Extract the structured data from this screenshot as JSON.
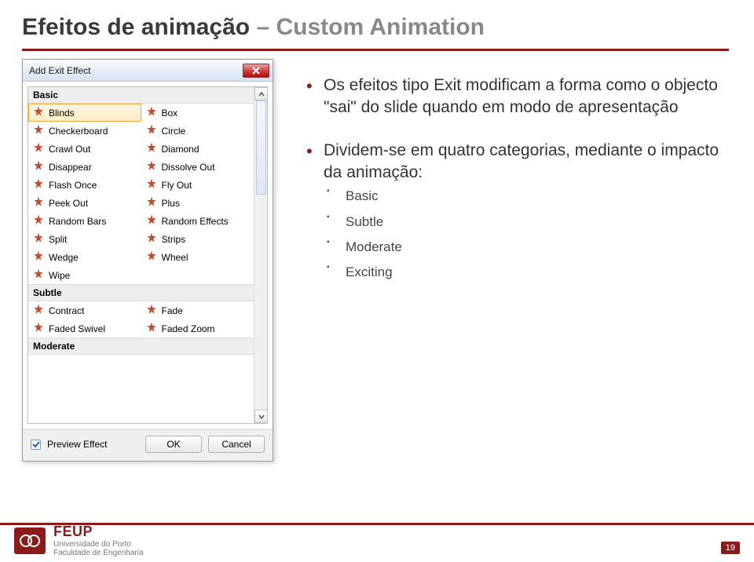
{
  "title": {
    "dark": "Efeitos de animação",
    "light": " – Custom Animation"
  },
  "dialog": {
    "title": "Add Exit Effect",
    "categories": [
      {
        "name": "Basic",
        "effects": [
          "Blinds",
          "Box",
          "Checkerboard",
          "Circle",
          "Crawl Out",
          "Diamond",
          "Disappear",
          "Dissolve Out",
          "Flash Once",
          "Fly Out",
          "Peek Out",
          "Plus",
          "Random Bars",
          "Random Effects",
          "Split",
          "Strips",
          "Wedge",
          "Wheel",
          "Wipe"
        ]
      },
      {
        "name": "Subtle",
        "effects": [
          "Contract",
          "Fade",
          "Faded Swivel",
          "Faded Zoom"
        ]
      },
      {
        "name": "Moderate",
        "effects": []
      }
    ],
    "selected_effect": "Blinds",
    "preview_label": "Preview Effect",
    "preview_checked": true,
    "ok_label": "OK",
    "cancel_label": "Cancel"
  },
  "bullets": {
    "b1": "Os efeitos tipo Exit modificam a forma como o objecto \"sai\" do slide quando em modo de apresentação",
    "b2": "Dividem-se em quatro categorias, mediante o impacto da animação:",
    "sub": [
      "Basic",
      "Subtle",
      "Moderate",
      "Exciting"
    ]
  },
  "footer": {
    "acronym": "FEUP",
    "line1": "Universidade do Porto",
    "line2": "Faculdade de Engenharia",
    "page_number": "19"
  }
}
